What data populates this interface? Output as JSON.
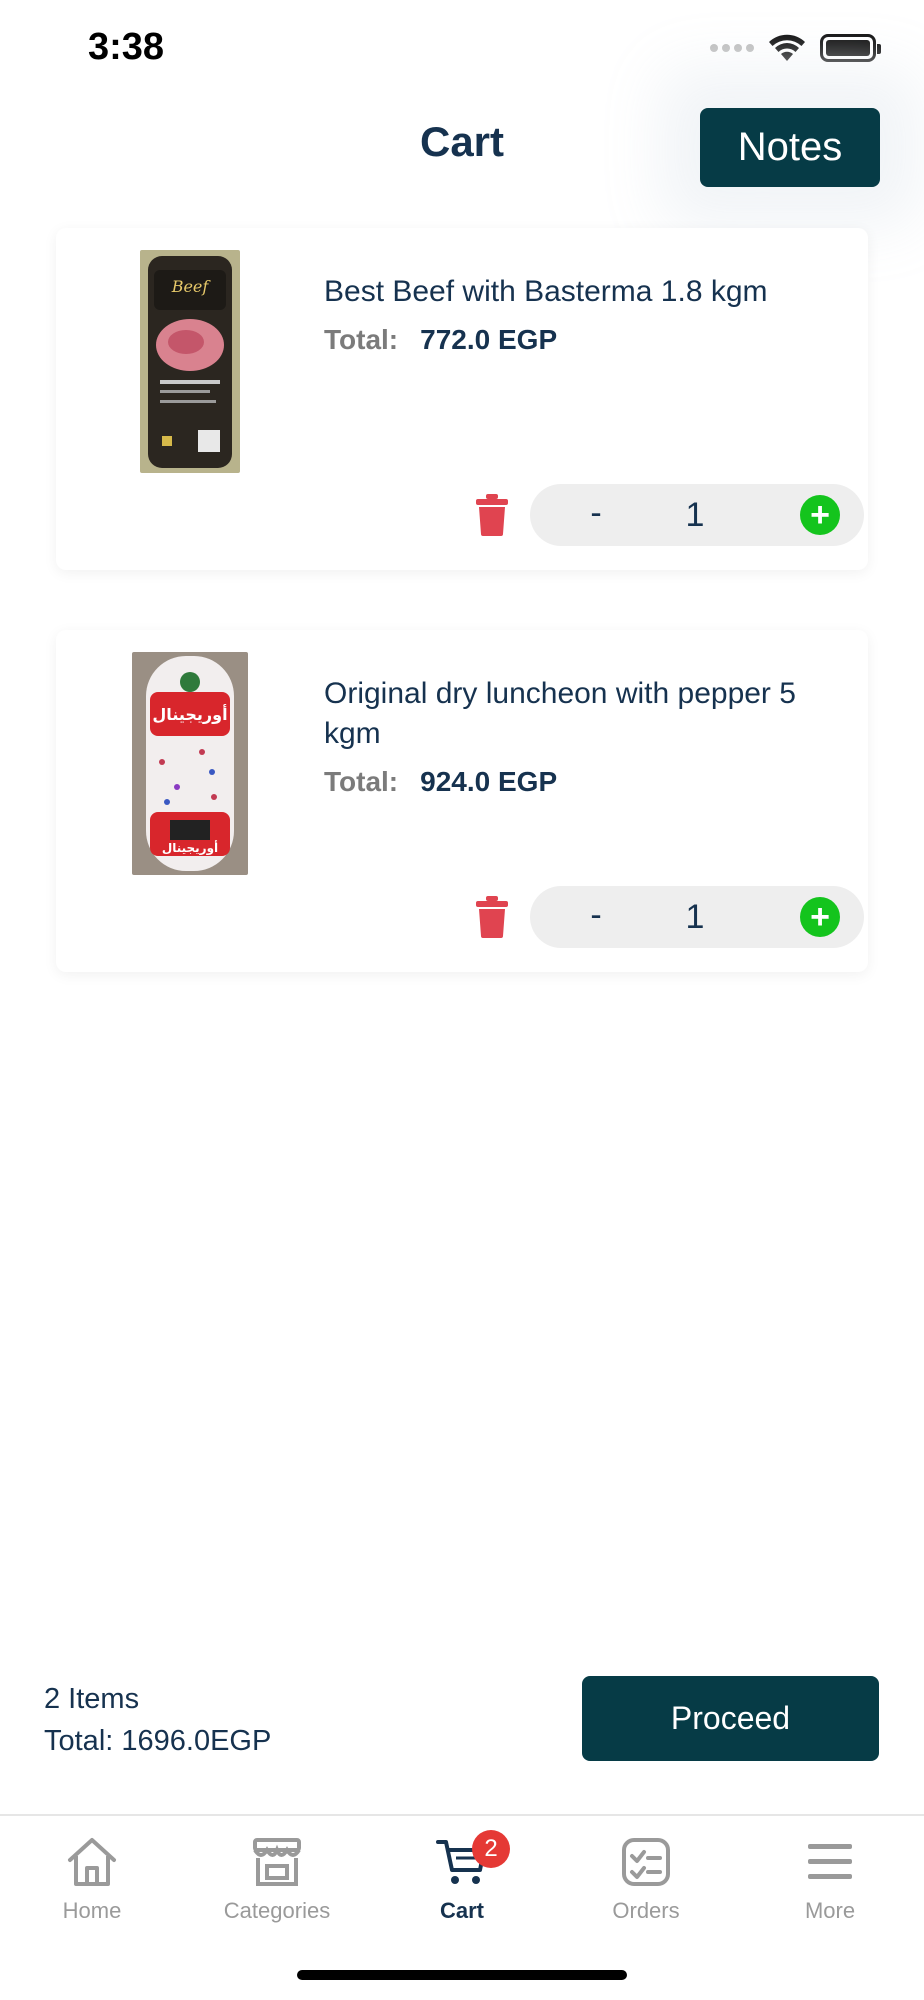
{
  "status_bar": {
    "time": "3:38"
  },
  "header": {
    "title": "Cart",
    "notes_label": "Notes"
  },
  "cart_items": [
    {
      "name": "Best Beef with Basterma 1.8 kgm",
      "total_label": "Total:",
      "total_value": "772.0 EGP",
      "minus": "-",
      "quantity": "1",
      "plus": "+"
    },
    {
      "name": "Original dry luncheon with pepper 5 kgm",
      "total_label": "Total:",
      "total_value": "924.0 EGP",
      "minus": "-",
      "quantity": "1",
      "plus": "+"
    }
  ],
  "summary": {
    "items_count": "2 Items",
    "total": "Total: 1696.0EGP",
    "proceed_label": "Proceed"
  },
  "tab_bar": {
    "tabs": [
      {
        "label": "Home",
        "icon": "home-icon"
      },
      {
        "label": "Categories",
        "icon": "store-icon"
      },
      {
        "label": "Cart",
        "icon": "cart-icon",
        "badge": "2"
      },
      {
        "label": "Orders",
        "icon": "orders-icon"
      },
      {
        "label": "More",
        "icon": "menu-icon"
      }
    ]
  },
  "colors": {
    "primary": "#063b46",
    "text": "#16324f",
    "delete": "#e04450",
    "plus": "#14c41d",
    "badge": "#e53935"
  }
}
